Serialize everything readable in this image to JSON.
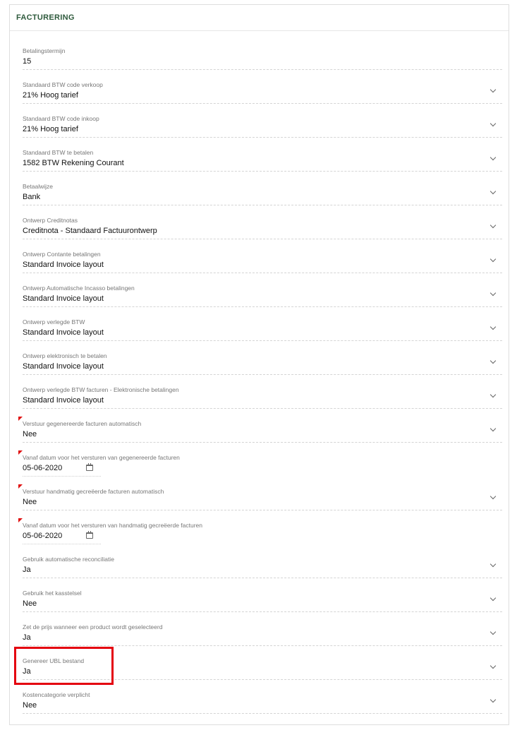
{
  "section": {
    "title": "FACTURERING"
  },
  "fields": [
    {
      "label": "Betalingstermijn",
      "value": "15"
    },
    {
      "label": "Standaard BTW code verkoop",
      "value": "21% Hoog tarief"
    },
    {
      "label": "Standaard BTW code inkoop",
      "value": "21% Hoog tarief"
    },
    {
      "label": "Standaard BTW te betalen",
      "value": "1582 BTW Rekening Courant"
    },
    {
      "label": "Betaalwijze",
      "value": "Bank"
    },
    {
      "label": "Ontwerp Creditnotas",
      "value": "Creditnota - Standaard Factuurontwerp"
    },
    {
      "label": "Ontwerp Contante betalingen",
      "value": "Standard Invoice layout"
    },
    {
      "label": "Ontwerp Automatische Incasso betalingen",
      "value": "Standard Invoice layout"
    },
    {
      "label": "Ontwerp verlegde BTW",
      "value": "Standard Invoice layout"
    },
    {
      "label": "Ontwerp elektronisch te betalen",
      "value": "Standard Invoice layout"
    },
    {
      "label": "Ontwerp verlegde BTW facturen - Elektronische betalingen",
      "value": "Standard Invoice layout"
    },
    {
      "label": "Verstuur gegenereerde facturen automatisch",
      "value": "Nee"
    },
    {
      "label": "Vanaf datum voor het versturen van gegenereerde facturen",
      "value": "05-06-2020"
    },
    {
      "label": "Verstuur handmatig gecreëerde facturen automatisch",
      "value": "Nee"
    },
    {
      "label": "Vanaf datum voor het versturen van handmatig gecreëerde facturen",
      "value": "05-06-2020"
    },
    {
      "label": "Gebruik automatische reconciliatie",
      "value": "Ja"
    },
    {
      "label": "Gebruik het kasstelsel",
      "value": "Nee"
    },
    {
      "label": "Zet de prijs wanneer een product wordt geselecteerd",
      "value": "Ja"
    },
    {
      "label": "Genereer UBL bestand",
      "value": "Ja"
    },
    {
      "label": "Kostencategorie verplicht",
      "value": "Nee"
    }
  ],
  "colors": {
    "title": "#2e5a3c",
    "required_marker": "#e01010",
    "highlight": "#e4000f"
  }
}
